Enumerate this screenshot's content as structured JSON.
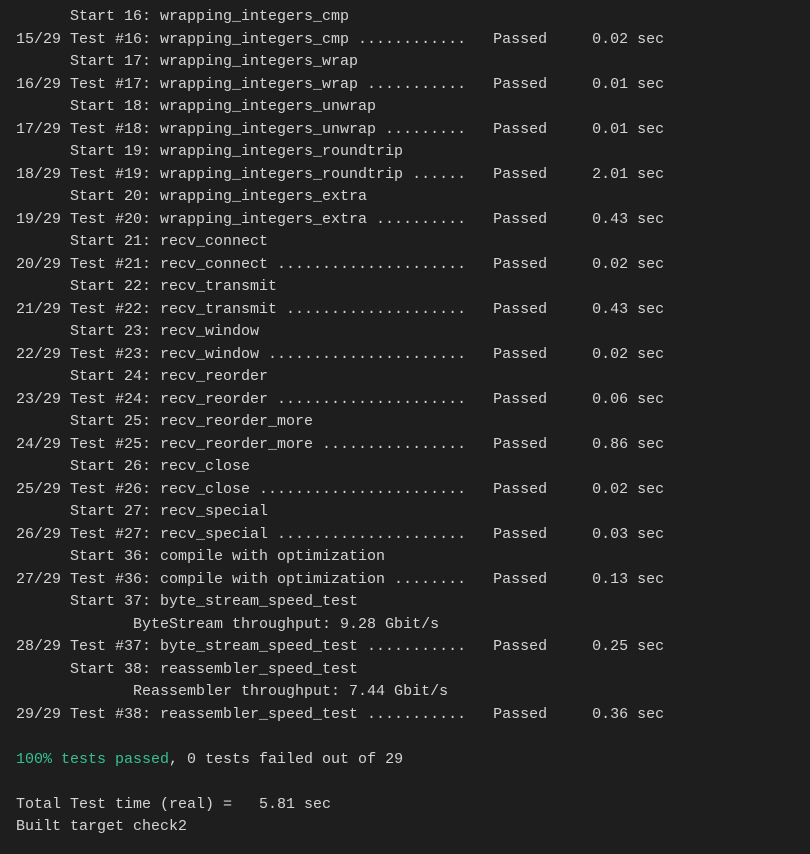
{
  "total_tests": 29,
  "start_column_width": 6,
  "prefix_column_width": 6,
  "test_label_width": 10,
  "name_column_width": 34,
  "status_column_width": 10,
  "time_column_width": 5,
  "tests": [
    {
      "start_num": 16,
      "num": 16,
      "name": "wrapping_integers_cmp",
      "status": "Passed",
      "time": "0.02"
    },
    {
      "start_num": 17,
      "num": 17,
      "name": "wrapping_integers_wrap",
      "status": "Passed",
      "time": "0.01"
    },
    {
      "start_num": 18,
      "num": 18,
      "name": "wrapping_integers_unwrap",
      "status": "Passed",
      "time": "0.01"
    },
    {
      "start_num": 19,
      "num": 19,
      "name": "wrapping_integers_roundtrip",
      "status": "Passed",
      "time": "2.01"
    },
    {
      "start_num": 20,
      "num": 20,
      "name": "wrapping_integers_extra",
      "status": "Passed",
      "time": "0.43"
    },
    {
      "start_num": 21,
      "num": 21,
      "name": "recv_connect",
      "status": "Passed",
      "time": "0.02"
    },
    {
      "start_num": 22,
      "num": 22,
      "name": "recv_transmit",
      "status": "Passed",
      "time": "0.43"
    },
    {
      "start_num": 23,
      "num": 23,
      "name": "recv_window",
      "status": "Passed",
      "time": "0.02"
    },
    {
      "start_num": 24,
      "num": 24,
      "name": "recv_reorder",
      "status": "Passed",
      "time": "0.06"
    },
    {
      "start_num": 25,
      "num": 25,
      "name": "recv_reorder_more",
      "status": "Passed",
      "time": "0.86"
    },
    {
      "start_num": 26,
      "num": 26,
      "name": "recv_close",
      "status": "Passed",
      "time": "0.02"
    },
    {
      "start_num": 27,
      "num": 27,
      "name": "recv_special",
      "status": "Passed",
      "time": "0.03"
    },
    {
      "start_num": 36,
      "num": 36,
      "name": "compile with optimization",
      "status": "Passed",
      "time": "0.13"
    },
    {
      "start_num": 37,
      "num": 37,
      "name": "byte_stream_speed_test",
      "status": "Passed",
      "time": "0.25",
      "extra": [
        "             ByteStream throughput: 9.28 Gbit/s"
      ]
    },
    {
      "start_num": 38,
      "num": 38,
      "name": "reassembler_speed_test",
      "status": "Passed",
      "time": "0.36",
      "extra": [
        "             Reassembler throughput: 7.44 Gbit/s"
      ]
    }
  ],
  "summary": {
    "pass_percent": "100% tests passed",
    "pass_rest": ", 0 tests failed out of 29"
  },
  "total_time_line": "Total Test time (real) =   5.81 sec",
  "built_line": "Built target check2",
  "start_label": "Start",
  "test_prefix": "Test",
  "sec_label": "sec"
}
